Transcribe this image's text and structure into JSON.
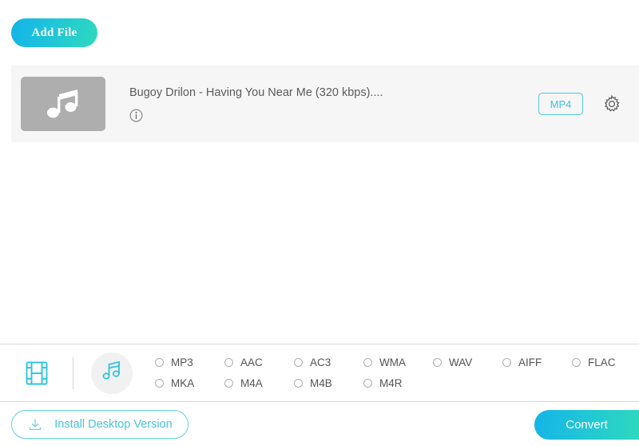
{
  "toolbar": {
    "add_file_label": "Add File"
  },
  "file_list": {
    "items": [
      {
        "title": "Bugoy Drilon - Having You Near Me (320 kbps)....",
        "thumb_icon": "music-note-icon",
        "info_icon": "info-icon",
        "output_format": "MP4",
        "settings_icon": "gear-icon"
      }
    ]
  },
  "format_panel": {
    "video_tab_icon": "film-strip-icon",
    "audio_tab_icon": "music-note-icon",
    "selected_tab": "audio",
    "options": [
      {
        "label": "MP3",
        "selected": false
      },
      {
        "label": "AAC",
        "selected": false
      },
      {
        "label": "AC3",
        "selected": false
      },
      {
        "label": "WMA",
        "selected": false
      },
      {
        "label": "WAV",
        "selected": false
      },
      {
        "label": "AIFF",
        "selected": false
      },
      {
        "label": "FLAC",
        "selected": false
      },
      {
        "label": "MKA",
        "selected": false
      },
      {
        "label": "M4A",
        "selected": false
      },
      {
        "label": "M4B",
        "selected": false
      },
      {
        "label": "M4R",
        "selected": false
      }
    ]
  },
  "bottom_bar": {
    "install_label": "Install Desktop Version",
    "install_icon": "download-icon",
    "convert_label": "Convert"
  },
  "colors": {
    "accent_start": "#14b4e8",
    "accent_end": "#2ed9bd",
    "accent_outline": "#4ec8e0",
    "row_background": "#f6f6f6",
    "thumb_background": "#aeaeae",
    "text_primary": "#5b5b5b",
    "divider": "#d8d8d8"
  }
}
